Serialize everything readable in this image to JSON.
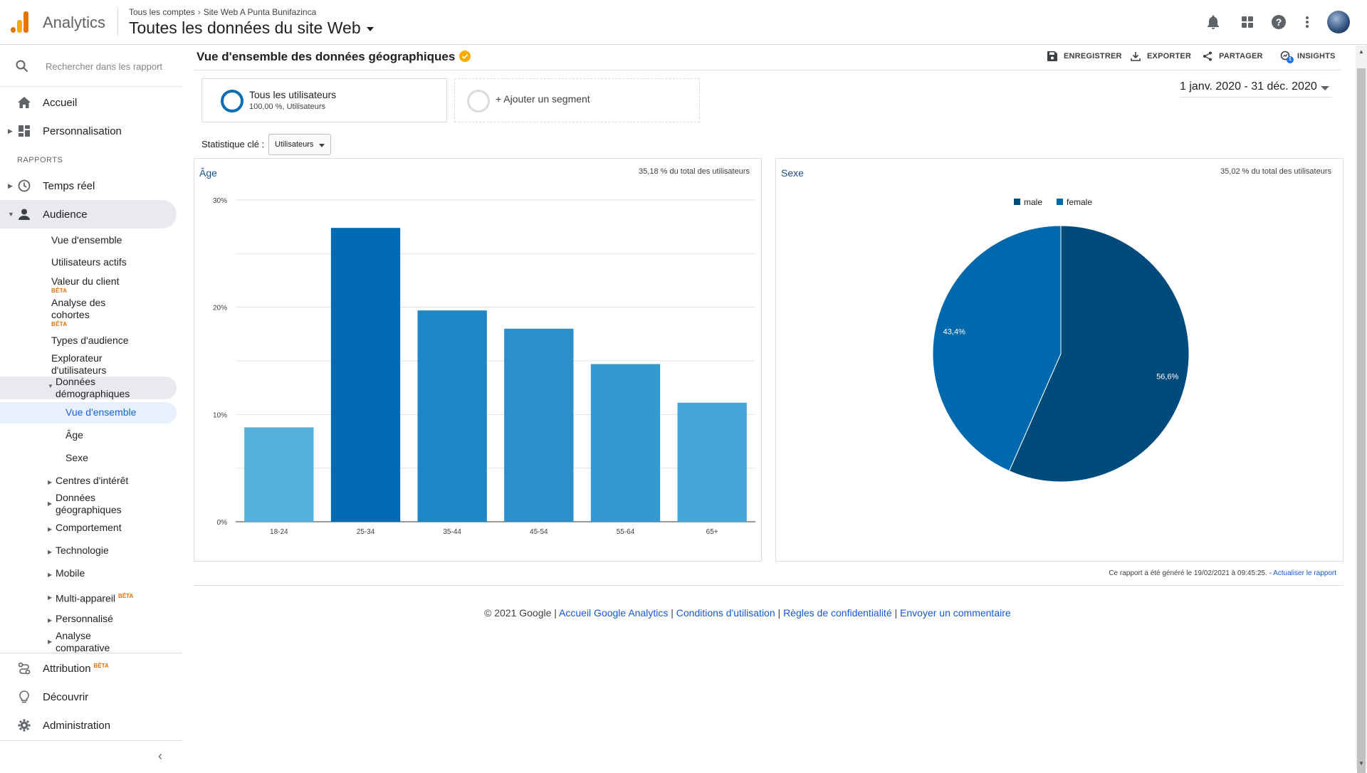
{
  "app": {
    "name": "Analytics"
  },
  "breadcrumb": {
    "account": "Tous les comptes",
    "property": "Site Web A Punta Bunifazinca"
  },
  "view": {
    "title": "Toutes les données du site Web"
  },
  "sidebar": {
    "search_placeholder": "Rechercher dans les rapport",
    "home": "Accueil",
    "customization": "Personnalisation",
    "section_reports": "RAPPORTS",
    "realtime": "Temps réel",
    "audience": "Audience",
    "audience_items": {
      "overview": "Vue d'ensemble",
      "active_users": "Utilisateurs actifs",
      "ltv": "Valeur du client",
      "ltv_badge": "BÊTA",
      "cohort_line1": "Analyse des",
      "cohort_line2": "cohortes",
      "cohort_badge": "BÊTA",
      "audiences": "Types d'audience",
      "explorer_line1": "Explorateur",
      "explorer_line2": "d'utilisateurs",
      "demographics_line1": "Données",
      "demographics_line2": "démographiques",
      "demo_overview": "Vue d'ensemble",
      "demo_age": "Âge",
      "demo_gender": "Sexe",
      "interests": "Centres d'intérêt",
      "geo_line1": "Données",
      "geo_line2": "géographiques",
      "behavior": "Comportement",
      "technology": "Technologie",
      "mobile": "Mobile",
      "cross_device": "Multi-appareil",
      "cross_device_badge": "BÊTA",
      "custom": "Personnalisé",
      "benchmark_line1": "Analyse",
      "benchmark_line2": "comparative"
    },
    "attribution": "Attribution",
    "attribution_badge": "BÊTA",
    "discover": "Découvrir",
    "admin": "Administration"
  },
  "report": {
    "title": "Vue d'ensemble des données géographiques",
    "actions": {
      "save": "ENREGISTRER",
      "export": "EXPORTER",
      "share": "PARTAGER",
      "insights": "INSIGHTS",
      "insights_count": "1"
    },
    "segment_all_title": "Tous les utilisateurs",
    "segment_all_sub": "100,00 %, Utilisateurs",
    "segment_add": "+ Ajouter un segment",
    "date_range": "1 janv. 2020 - 31 déc. 2020",
    "key_stat_label": "Statistique clé :",
    "key_stat_value": "Utilisateurs",
    "age_panel": {
      "title": "Âge",
      "note": "35,18 % du total des utilisateurs"
    },
    "gender_panel": {
      "title": "Sexe",
      "note": "35,02 % du total des utilisateurs"
    },
    "generated_text": "Ce rapport a été généré le 19/02/2021 à 09:45:25. - ",
    "refresh_link": "Actualiser le rapport"
  },
  "footer": {
    "copyright": "© 2021 Google | ",
    "link_home": "Accueil Google Analytics",
    "sep1": " | ",
    "link_terms": "Conditions d'utilisation",
    "sep2": " | ",
    "link_privacy": "Règles de confidentialité",
    "sep3": " | ",
    "link_feedback": "Envoyer un commentaire"
  },
  "chart_data": [
    {
      "type": "bar",
      "title": "Âge",
      "categories": [
        "18-24",
        "25-34",
        "35-44",
        "45-54",
        "55-64",
        "65+"
      ],
      "values": [
        8.8,
        27.4,
        19.7,
        18.0,
        14.7,
        11.1
      ],
      "colors": [
        "#55b0dc",
        "#006bb3",
        "#1e88c6",
        "#2a8fca",
        "#3499d1",
        "#45a6da"
      ],
      "y_ticks": [
        "0%",
        "10%",
        "20%",
        "30%"
      ],
      "ylim": [
        0,
        30
      ],
      "grid": true
    },
    {
      "type": "pie",
      "title": "Sexe",
      "legend": [
        "male",
        "female"
      ],
      "values": [
        56.6,
        43.4
      ],
      "labels": [
        "56,6%",
        "43,4%"
      ],
      "colors": [
        "#004a7c",
        "#0069ad"
      ],
      "legend_position": "top"
    }
  ]
}
